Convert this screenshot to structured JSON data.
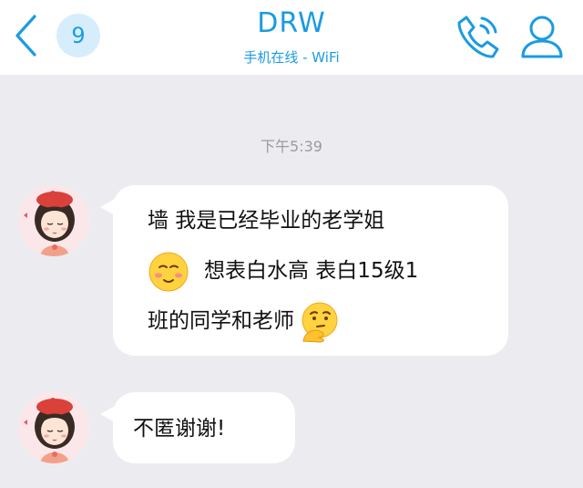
{
  "header": {
    "unread_count": "9",
    "title": "DRW",
    "subtitle": "手机在线 - WiFi"
  },
  "chat": {
    "timestamp": "下午5:39",
    "messages": [
      {
        "line1": "墙 我是已经毕业的老学姐",
        "line2": "想表白水高 表白15级1",
        "line3": "班的同学和老师",
        "emoji1": "blushing-face-emoji",
        "emoji2": "thinking-face-emoji"
      },
      {
        "text": "不匿谢谢!"
      }
    ]
  },
  "colors": {
    "accent": "#1a9be3",
    "badge_bg": "#d6eefb",
    "chat_bg": "#ececf0",
    "bubble_bg": "#ffffff"
  },
  "icons": [
    "chevron-left-icon",
    "phone-icon",
    "person-icon"
  ]
}
